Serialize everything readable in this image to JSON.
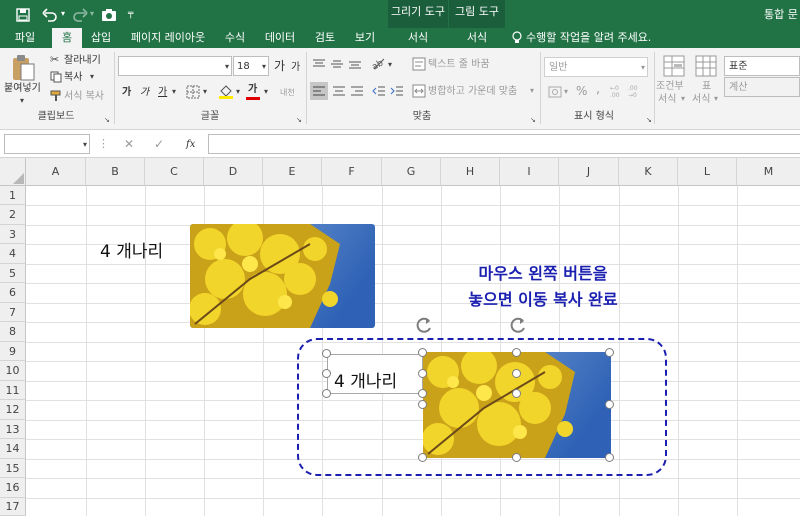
{
  "title_bar": {
    "save_icon": "save-icon",
    "undo_icon": "undo-icon",
    "redo_icon": "redo-icon",
    "camera_icon": "camera-icon",
    "customize_icon": "customize-quick-access-icon",
    "doc_title": "통합 문"
  },
  "context_tabs": {
    "drawing_tools": "그리기 도구",
    "picture_tools": "그림 도구"
  },
  "tabs": [
    "파일",
    "홈",
    "삽입",
    "페이지 레이아웃",
    "수식",
    "데이터",
    "검토",
    "보기"
  ],
  "context_tab_labels": [
    "서식",
    "서식"
  ],
  "tell_me": "수행할 작업을 알려 주세요.",
  "ribbon": {
    "clipboard": {
      "paste": "붙여넣기",
      "cut": "잘라내기",
      "copy": "복사",
      "format_painter": "서식 복사",
      "label": "클립보드"
    },
    "font": {
      "font_name": "",
      "font_size": "18",
      "grow": "가",
      "shrink": "가",
      "bold": "가",
      "italic": "가",
      "underline": "가",
      "font_color_letter": "가",
      "label": "글꼴",
      "phonetic": "내천"
    },
    "alignment": {
      "wrap_text": "텍스트 줄 바꿈",
      "merge_center": "병합하고 가운데 맞춤",
      "label": "맞춤"
    },
    "number": {
      "format": "일반",
      "percent": "%",
      "comma": ",",
      "label": "표시 형식"
    },
    "styles": {
      "conditional": "조건부",
      "conditional_2": "서식",
      "table": "표",
      "table_2": "서식",
      "style_normal": "표준",
      "style_calc": "계산"
    }
  },
  "formula_bar": {
    "name_box": "",
    "cancel": "✕",
    "enter": "✓",
    "fx": "fx",
    "value": ""
  },
  "sheet": {
    "columns": [
      "A",
      "B",
      "C",
      "D",
      "E",
      "F",
      "G",
      "H",
      "I",
      "J",
      "K",
      "L",
      "M"
    ],
    "rows": [
      "1",
      "2",
      "3",
      "4",
      "5",
      "6",
      "7",
      "8",
      "9",
      "10",
      "11",
      "12",
      "13",
      "14",
      "15",
      "16",
      "17"
    ]
  },
  "objects": {
    "label_original": "4 개나리",
    "label_copy": "4 개나리",
    "annotation_line1": "마우스 왼쪽 버튼을",
    "annotation_line2": "놓으면 이동 복사 완료",
    "annotation_color": "#1a1fb0",
    "dash_color": "#1a1fb0"
  },
  "colors": {
    "excel_green": "#217346",
    "context_green": "#1b5e3b"
  }
}
